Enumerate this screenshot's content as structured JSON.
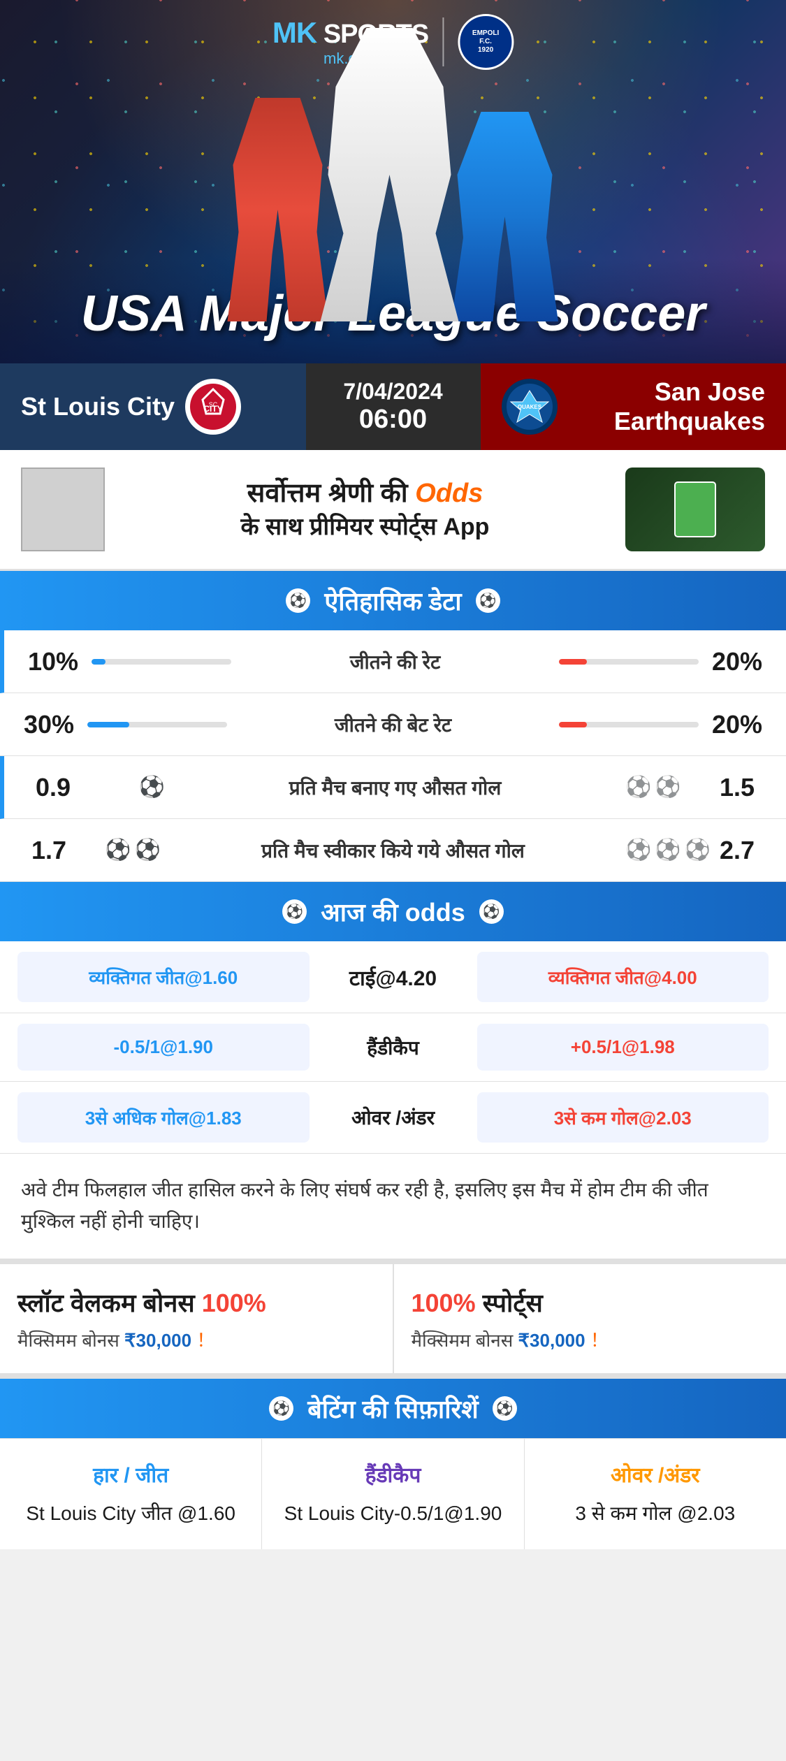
{
  "hero": {
    "brand_mk": "MK",
    "brand_sports": "SPORTS",
    "brand_url": "mk.com",
    "empoli_line1": "EMPOLI F.C.",
    "empoli_line2": "1920",
    "league_title": "USA Major League Soccer"
  },
  "match": {
    "home_team": "St Louis City",
    "away_team": "San Jose Earthquakes",
    "away_team_abbr": "QUAKES",
    "date": "7/04/2024",
    "time": "06:00"
  },
  "promo": {
    "headline": "सर्वोत्तम श्रेणी की",
    "odds_word": "Odds",
    "subheadline": "के साथ प्रीमियर स्पोर्ट्स App"
  },
  "historical": {
    "section_title": "ऐतिहासिक डेटा",
    "rows": [
      {
        "label": "जीतने की रेट",
        "left_val": "10%",
        "right_val": "20%",
        "left_fill": 10,
        "right_fill": 20
      },
      {
        "label": "जीतने की बेट रेट",
        "left_val": "30%",
        "right_val": "20%",
        "left_fill": 30,
        "right_fill": 20
      },
      {
        "label": "प्रति मैच बनाए गए औसत गोल",
        "left_val": "0.9",
        "right_val": "1.5",
        "left_icons": 1,
        "right_icons": 2
      },
      {
        "label": "प्रति मैच स्वीकार किये गये औसत गोल",
        "left_val": "1.7",
        "right_val": "2.7",
        "left_icons": 2,
        "right_icons": 3
      }
    ]
  },
  "odds": {
    "section_title": "आज की odds",
    "rows": [
      {
        "left_btn": "व्यक्तिगत जीत@1.60",
        "center_label": "टाई@4.20",
        "right_btn": "व्यक्तिगत जीत@4.00",
        "right_red": true
      },
      {
        "left_btn": "-0.5/1@1.90",
        "center_label": "हैंडीकैप",
        "right_btn": "+0.5/1@1.98",
        "right_red": true
      },
      {
        "left_btn": "3से अधिक गोल@1.83",
        "center_label": "ओवर /अंडर",
        "right_btn": "3से कम गोल@2.03",
        "right_red": true
      }
    ]
  },
  "analysis": {
    "text": "अवे टीम फिलहाल जीत हासिल करने के लिए संघर्ष कर रही है, इसलिए इस मैच में होम टीम की जीत मुश्किल नहीं होनी चाहिए।"
  },
  "bonus": {
    "card1_title": "स्लॉट वेलकम बोनस",
    "card1_percent": "100%",
    "card1_sub_pre": "मैक्सिमम बोनस",
    "card1_amount": "₹30,000",
    "card1_exclaim": "！",
    "card2_title_red": "100%",
    "card2_title_rest": "स्पोर्ट्स",
    "card2_sub_pre": "मैक्सिमम बोनस",
    "card2_amount": "₹30,000",
    "card2_exclaim": "！"
  },
  "betting_reco": {
    "section_title": "बेटिंग की सिफ़ारिशें",
    "col1_label": "हार / जीत",
    "col1_value": "St Louis City जीत @1.60",
    "col2_label": "हैंडीकैप",
    "col2_value": "St Louis City-0.5/1@1.90",
    "col3_label": "ओवर /अंडर",
    "col3_value": "3 से कम गोल @2.03"
  }
}
